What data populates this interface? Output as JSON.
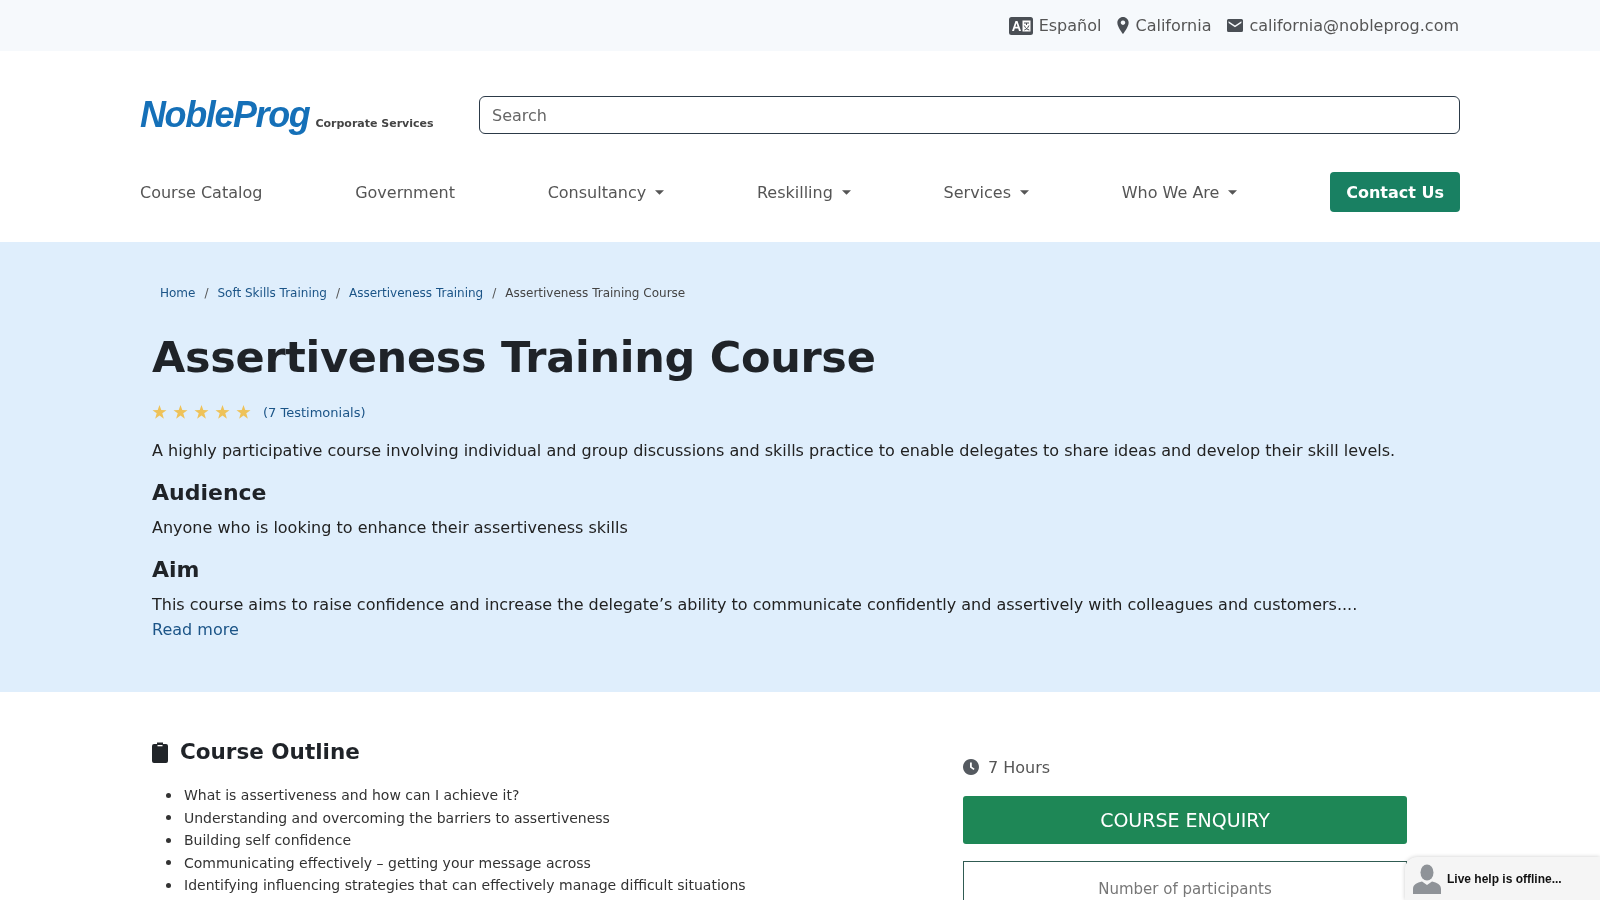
{
  "top_bar": {
    "items": [
      {
        "kind": "language",
        "label": "Español"
      },
      {
        "kind": "location",
        "label": "California"
      },
      {
        "kind": "email",
        "label": "california@nobleprog.com"
      }
    ]
  },
  "header": {
    "logo": "NobleProg",
    "tagline": "Corporate Services",
    "search": {
      "placeholder": "Search"
    }
  },
  "nav": {
    "items": [
      {
        "kind": "link",
        "label": "Course Catalog"
      },
      {
        "kind": "link",
        "label": "Government"
      },
      {
        "kind": "dropdown",
        "label": "Consultancy"
      },
      {
        "kind": "dropdown",
        "label": "Reskilling"
      },
      {
        "kind": "dropdown",
        "label": "Services"
      },
      {
        "kind": "dropdown",
        "label": "Who We Are"
      },
      {
        "kind": "button",
        "label": "Contact Us"
      }
    ]
  },
  "breadcrumb": [
    {
      "kind": "link",
      "label": "Home"
    },
    {
      "kind": "separator",
      "label": "/"
    },
    {
      "kind": "link",
      "label": "Soft Skills Training"
    },
    {
      "kind": "separator",
      "label": "/"
    },
    {
      "kind": "link",
      "label": "Assertiveness Training"
    },
    {
      "kind": "separator",
      "label": "/"
    },
    {
      "kind": "current",
      "label": "Assertiveness Training Course"
    }
  ],
  "hero": {
    "title": "Assertiveness Training Course",
    "stars": 5,
    "testimonials": "(7 Testimonials)",
    "summary": "A highly participative course involving individual and group discussions and skills practice to enable delegates to share ideas and develop their skill levels.",
    "sections": [
      {
        "heading": "Audience",
        "text": "Anyone who is looking to enhance their assertiveness skills"
      },
      {
        "heading": "Aim",
        "text": "This course aims to raise confidence and increase the delegate’s ability to communicate confidently and assertively with colleagues and customers...."
      }
    ],
    "read_more": "Read more"
  },
  "outline": {
    "title": "Course Outline",
    "items": [
      "What is assertiveness and how can I achieve it?",
      "Understanding and overcoming the barriers to assertiveness",
      "Building self confidence",
      "Communicating effectively – getting your message across",
      "Identifying influencing strategies that can effectively manage difficult situations"
    ]
  },
  "sidebar": {
    "duration": "7 Hours",
    "enquiry_button": "COURSE ENQUIRY",
    "participants_label": "Number of participants"
  },
  "live_help": {
    "text": "Live help is offline..."
  }
}
